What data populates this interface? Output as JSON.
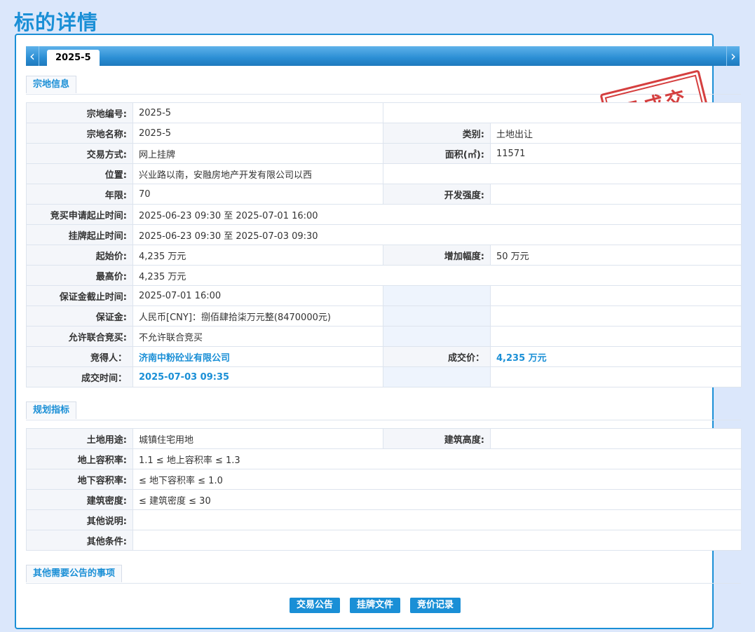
{
  "page": {
    "title": "标的详情"
  },
  "tabs": [
    {
      "label": "2025-5"
    }
  ],
  "stamp": {
    "text": "已成交",
    "color": "#d12b2b"
  },
  "sections": {
    "parcel": {
      "title": "宗地信息"
    },
    "planning": {
      "title": "规划指标"
    },
    "other": {
      "title": "其他需要公告的事项"
    }
  },
  "parcel": {
    "number": {
      "label": "宗地编号:",
      "value": "2025-5"
    },
    "name": {
      "label": "宗地名称:",
      "value": "2025-5"
    },
    "category": {
      "label": "类别:",
      "value": "土地出让"
    },
    "trade_mode": {
      "label": "交易方式:",
      "value": "网上挂牌"
    },
    "area": {
      "label": "面积(㎡):",
      "value": "11571"
    },
    "location": {
      "label": "位置:",
      "value": "兴业路以南，安融房地产开发有限公司以西"
    },
    "term": {
      "label": "年限:",
      "value": "70"
    },
    "intensity": {
      "label": "开发强度:",
      "value": ""
    },
    "apply_period": {
      "label": "竞买申请起止时间:",
      "value": "2025-06-23 09:30 至 2025-07-01 16:00"
    },
    "listing_period": {
      "label": "挂牌起止时间:",
      "value": "2025-06-23 09:30 至 2025-07-03 09:30"
    },
    "start_price": {
      "label": "起始价:",
      "value": "4,235 万元"
    },
    "increment": {
      "label": "增加幅度:",
      "value": "50 万元"
    },
    "highest_price": {
      "label": "最高价:",
      "value": "4,235 万元"
    },
    "deposit_deadline": {
      "label": "保证金截止时间:",
      "value": "2025-07-01 16:00"
    },
    "deposit": {
      "label": "保证金:",
      "value": "人民币[CNY]：捌佰肆拾柒万元整(8470000元)"
    },
    "joint_bid": {
      "label": "允许联合竞买:",
      "value": "不允许联合竞买"
    },
    "winner": {
      "label": "竞得人：",
      "value": "济南中粉砼业有限公司"
    },
    "deal_price": {
      "label": "成交价：",
      "value": "4,235 万元"
    },
    "deal_time": {
      "label": "成交时间：",
      "value": "2025-07-03 09:35"
    }
  },
  "planning": {
    "land_use": {
      "label": "土地用途:",
      "value": "城镇住宅用地"
    },
    "building_height": {
      "label": "建筑高度:",
      "value": ""
    },
    "far_above": {
      "label": "地上容积率:",
      "value": "1.1 ≤ 地上容积率 ≤ 1.3"
    },
    "far_below": {
      "label": "地下容积率:",
      "value": "≤ 地下容积率 ≤ 1.0"
    },
    "density": {
      "label": "建筑密度:",
      "value": "≤ 建筑密度 ≤ 30"
    },
    "other_notes": {
      "label": "其他说明:",
      "value": ""
    },
    "other_conditions": {
      "label": "其他条件:",
      "value": ""
    }
  },
  "buttons": {
    "announcement": "交易公告",
    "listing_docs": "挂牌文件",
    "bid_records": "竞价记录"
  },
  "colors": {
    "accent": "#1a8fd6",
    "background": "#dbe7fb"
  }
}
